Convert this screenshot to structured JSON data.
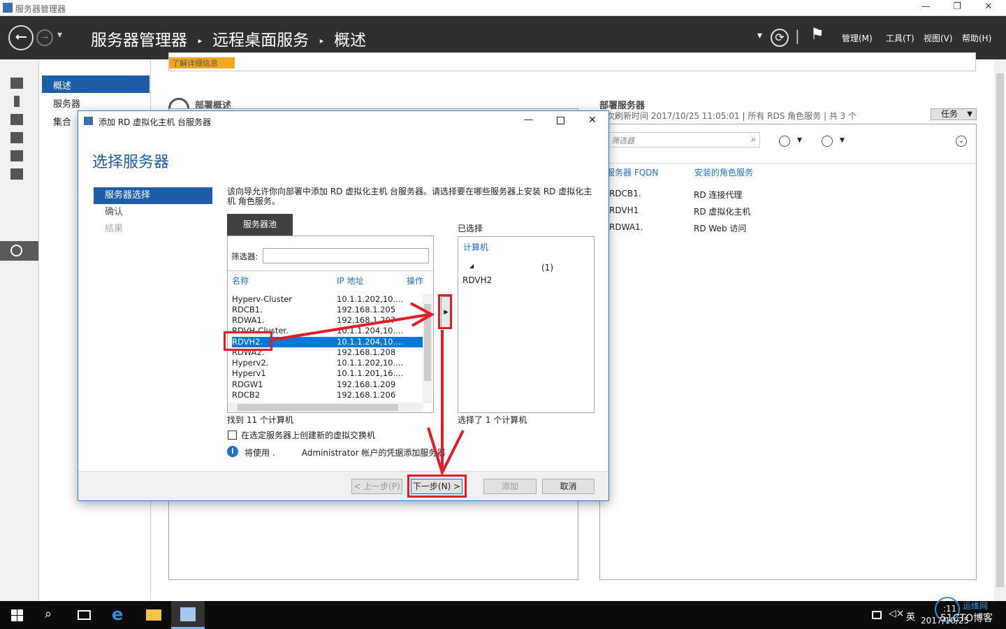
{
  "window": {
    "title": "服务器管理器",
    "min": "—",
    "restore": "❐",
    "close": "✕"
  },
  "header": {
    "breadcrumb": [
      "服务器管理器",
      "远程桌面服务",
      "概述"
    ],
    "sep": "‣",
    "menus": [
      "管理(M)",
      "工具(T)",
      "视图(V)",
      "帮助(H)"
    ],
    "refresh": "⟳",
    "flag": "⚑",
    "dropdown": "▾",
    "pipe": "|"
  },
  "subnav": {
    "items": [
      "概述",
      "服务器",
      "集合"
    ]
  },
  "main": {
    "notice": "了解详细信息",
    "overview_title": "部署概述",
    "deploy_servers": {
      "title": "部署服务器",
      "subtitle": "次刷新时间 2017/10/25 11:05:01 | 所有 RDS 角色服务 | 共 3 个",
      "tasks": "任务",
      "filter_placeholder": "筛选器",
      "col_fqdn": "服务器 FQDN",
      "col_roles": "安装的角色服务",
      "rows": [
        {
          "fqdn": "RDCB1.",
          "role": "RD 连接代理"
        },
        {
          "fqdn": "RDVH1",
          "role": "RD 虚拟化主机"
        },
        {
          "fqdn": "RDWA1.",
          "role": "RD Web 访问"
        }
      ]
    }
  },
  "dialog": {
    "title": "添加 RD 虚拟化主机 台服务器",
    "heading": "选择服务器",
    "steps": [
      "服务器选择",
      "确认",
      "结果"
    ],
    "description": "该向导允许你向部署中添加 RD 虚拟化主机 台服务器。请选择要在哪些服务器上安装 RD 虚拟化主机 角色服务。",
    "pool_tab": "服务器池",
    "filter_label": "筛选器:",
    "columns": {
      "name": "名称",
      "ip": "IP 地址",
      "op": "操作"
    },
    "servers": [
      {
        "name": "Hyperv-Cluster",
        "ip": "10.1.1.202,10...."
      },
      {
        "name": "RDCB1.",
        "ip": "192.168.1.205"
      },
      {
        "name": "RDWA1.",
        "ip": "192.168.1.207"
      },
      {
        "name": "RDVH-Cluster.",
        "ip": "10.1.1.204,10...."
      },
      {
        "name": "RDVH2.",
        "ip": "10.1.1.204,10...."
      },
      {
        "name": "RDWA2.",
        "ip": "192.168.1.208"
      },
      {
        "name": "Hyperv2.",
        "ip": "10.1.1.202,10...."
      },
      {
        "name": "Hyperv1",
        "ip": "10.1.1.201,16...."
      },
      {
        "name": "RDGW1",
        "ip": "192.168.1.209"
      },
      {
        "name": "RDCB2",
        "ip": "192.168.1.206"
      }
    ],
    "found": "找到 11 个计算机",
    "selected_title": "已选择",
    "selected_col": "计算机",
    "selected_group": "(1)",
    "selected_items": [
      "RDVH2"
    ],
    "selected_count": "选择了 1 个计算机",
    "checkbox_label": "在选定服务器上创建新的虚拟交换机",
    "info": "将使用 .          Administrator 帐户的凭据添加服务器",
    "buttons": {
      "prev": "< 上一步(P)",
      "next": "下一步(N) >",
      "add": "添加",
      "cancel": "取消"
    },
    "move_arrow": "▸"
  },
  "taskbar": {
    "ime": "英",
    "time": ":11",
    "date": "2017/10/25",
    "watermark": "51CTO博客",
    "watermark2": "运维网"
  },
  "colors": {
    "accent": "#1e70c8",
    "header_bg": "#2f2f2f",
    "selection": "#0078d7",
    "annotation": "#e11d2a"
  }
}
